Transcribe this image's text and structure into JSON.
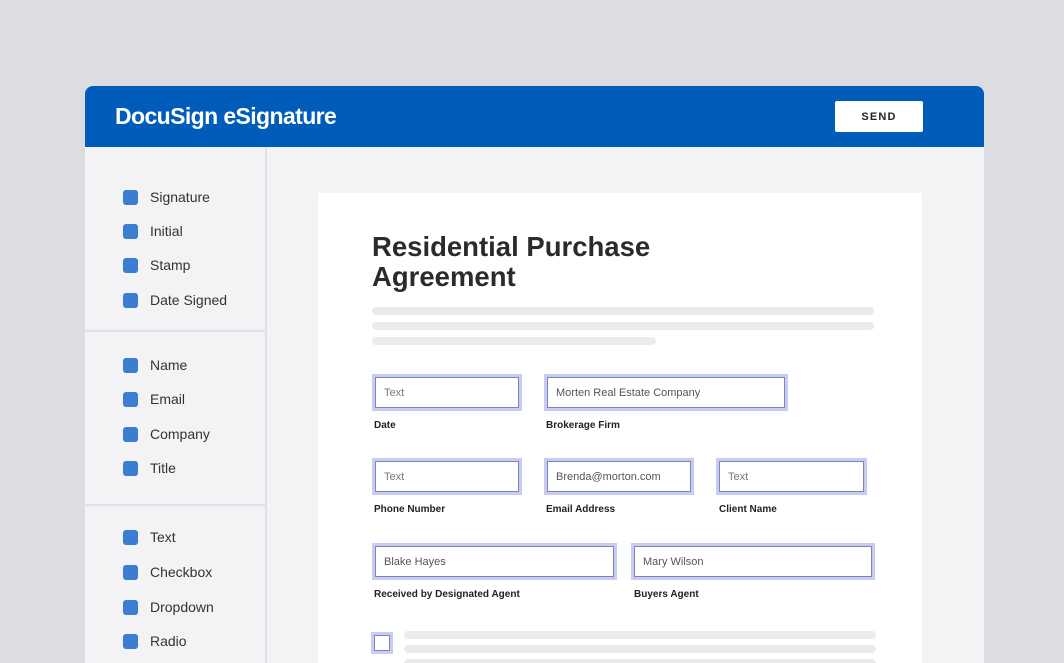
{
  "app": {
    "brand": "DocuSign eSignature",
    "send_label": "SEND"
  },
  "sidebar": {
    "groups": [
      {
        "items": [
          {
            "label": "Signature"
          },
          {
            "label": "Initial"
          },
          {
            "label": "Stamp"
          },
          {
            "label": "Date Signed"
          }
        ]
      },
      {
        "items": [
          {
            "label": "Name"
          },
          {
            "label": "Email"
          },
          {
            "label": "Company"
          },
          {
            "label": "Title"
          }
        ]
      },
      {
        "items": [
          {
            "label": "Text"
          },
          {
            "label": "Checkbox"
          },
          {
            "label": "Dropdown"
          },
          {
            "label": "Radio"
          }
        ]
      }
    ]
  },
  "document": {
    "title": "Residential Purchase Agreement",
    "fields": {
      "date": {
        "placeholder": "Text",
        "value": "",
        "label": "Date"
      },
      "brokerage": {
        "placeholder": "",
        "value": "Morten Real Estate Company",
        "label": "Brokerage Firm"
      },
      "phone": {
        "placeholder": "Text",
        "value": "",
        "label": "Phone Number"
      },
      "email": {
        "placeholder": "",
        "value": "Brenda@morton.com",
        "label": "Email Address"
      },
      "client": {
        "placeholder": "Text",
        "value": "",
        "label": "Client Name"
      },
      "received": {
        "placeholder": "",
        "value": "Blake Hayes",
        "label": "Received by Designated Agent"
      },
      "buyers": {
        "placeholder": "",
        "value": "Mary Wilson",
        "label": "Buyers Agent"
      }
    }
  },
  "colors": {
    "brand_blue": "#005cb9",
    "field_icon_blue": "#3b7dd0"
  }
}
